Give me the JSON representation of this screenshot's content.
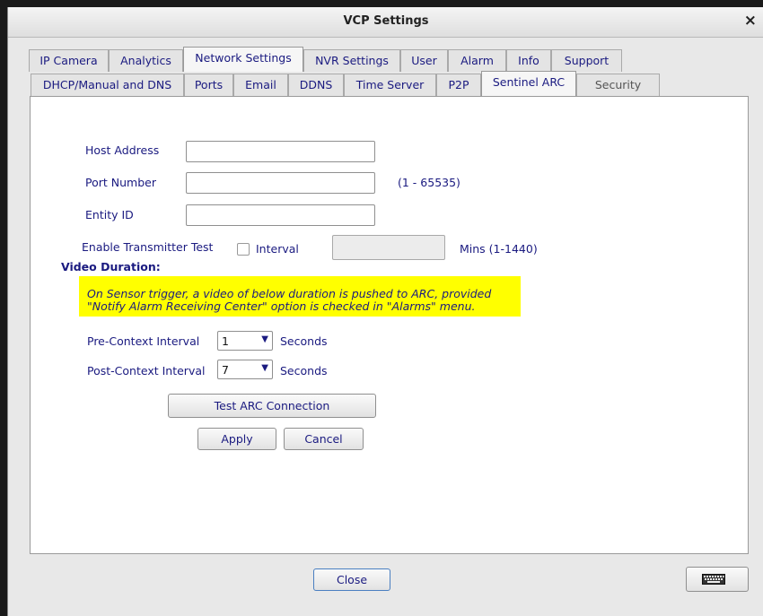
{
  "window": {
    "title": "VCP Settings",
    "close_glyph": "×"
  },
  "main_tabs": [
    "IP Camera",
    "Analytics",
    "Network Settings",
    "NVR Settings",
    "User",
    "Alarm",
    "Info",
    "Support"
  ],
  "sub_tabs": [
    "DHCP/Manual and DNS",
    "Ports",
    "Email",
    "DDNS",
    "Time Server",
    "P2P",
    "Sentinel ARC",
    "Security"
  ],
  "active_main_tab": "Network Settings",
  "active_sub_tab": "Sentinel ARC",
  "form": {
    "host_address": {
      "label": "Host Address",
      "value": ""
    },
    "port_number": {
      "label": "Port Number",
      "value": "",
      "hint": "(1 - 65535)"
    },
    "entity_id": {
      "label": "Entity ID",
      "value": ""
    },
    "transmitter_test": {
      "label": "Enable Transmitter Test",
      "interval_label": "Interval",
      "value": "",
      "unit": "Mins (1-1440)",
      "checked": false
    },
    "video_duration_heading": "Video Duration:",
    "note_line1": "On Sensor trigger, a video of below duration is pushed to ARC, provided",
    "note_line2": "\"Notify Alarm Receiving Center\" option is checked in \"Alarms\" menu.",
    "pre_context": {
      "label": "Pre-Context Interval",
      "value": "1",
      "unit": "Seconds"
    },
    "post_context": {
      "label": "Post-Context Interval",
      "value": "7",
      "unit": "Seconds"
    },
    "test_button": "Test ARC Connection",
    "apply_button": "Apply",
    "cancel_button": "Cancel"
  },
  "footer": {
    "close_button": "Close",
    "keyboard_icon": "keyboard-icon"
  },
  "colors": {
    "label_text": "#1a1a80",
    "note_background": "#ffff00",
    "panel": "#ffffff"
  }
}
